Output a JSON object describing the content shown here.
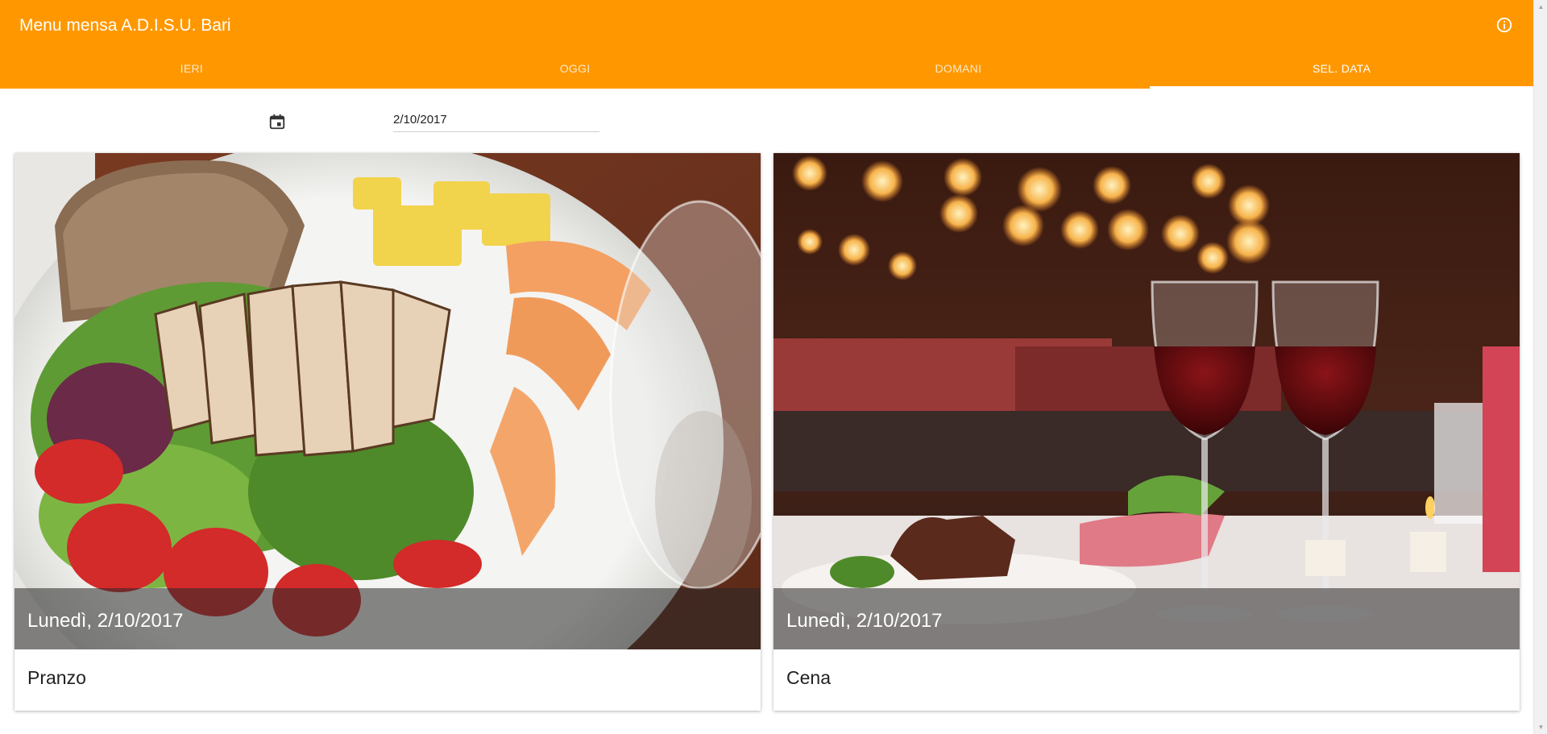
{
  "appbar": {
    "title": "Menu mensa A.D.I.S.U. Bari",
    "info_icon": "info-icon",
    "color": "#ff9800"
  },
  "tabs": [
    {
      "label": "IERI",
      "active": false
    },
    {
      "label": "OGGI",
      "active": false
    },
    {
      "label": "DOMANI",
      "active": false
    },
    {
      "label": "SEL. DATA",
      "active": true
    }
  ],
  "date_picker": {
    "icon": "calendar-icon",
    "value": "2/10/2017"
  },
  "cards": [
    {
      "caption": "Lunedì, 2/10/2017",
      "title": "Pranzo",
      "image": "salad-with-grilled-chicken"
    },
    {
      "caption": "Lunedì, 2/10/2017",
      "title": "Cena",
      "image": "dinner-table-with-wine-glasses"
    }
  ]
}
